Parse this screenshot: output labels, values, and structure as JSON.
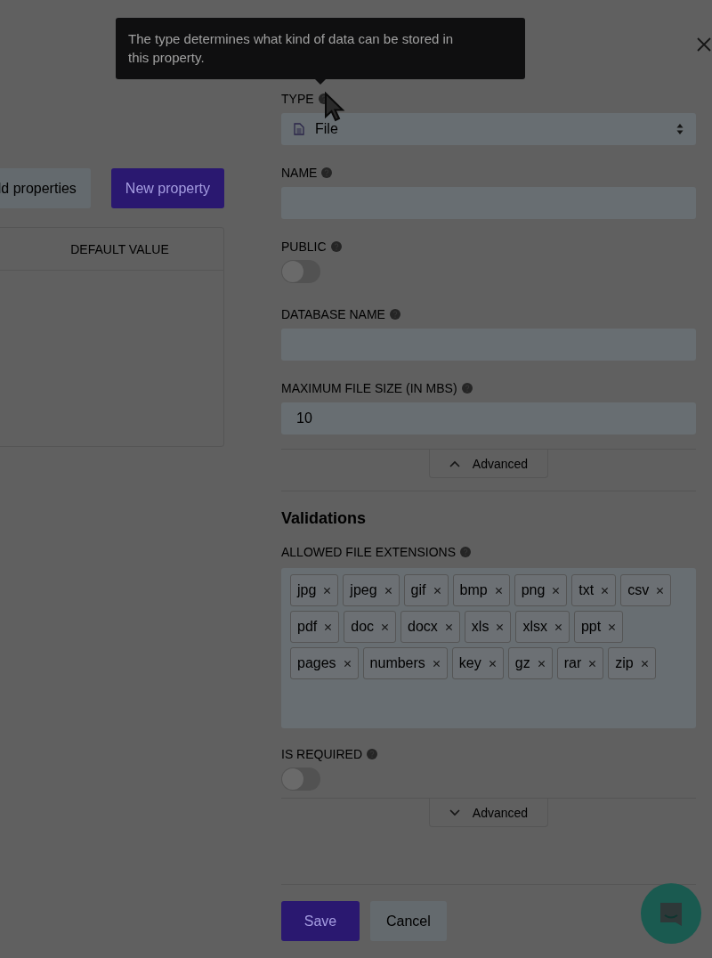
{
  "background_page": {
    "buttons": [
      {
        "label": "ld properties",
        "kind": "secondary"
      },
      {
        "label": "New property",
        "kind": "primary"
      }
    ],
    "table": {
      "columns": [
        "DEFAULT VALUE"
      ]
    }
  },
  "tooltip": {
    "text": "The type determines what kind of data can be stored in this property."
  },
  "form": {
    "fields": [
      {
        "label": "TYPE",
        "kind": "select",
        "value": "File"
      },
      {
        "label": "NAME",
        "kind": "text"
      },
      {
        "label": "PUBLIC",
        "kind": "toggle",
        "on": false
      },
      {
        "label": "DATABASE NAME",
        "kind": "text"
      },
      {
        "label": "MAXIMUM FILE SIZE (IN MBS)",
        "kind": "text",
        "value": "10"
      },
      {
        "label": "Advanced",
        "kind": "advanced",
        "expanded": true
      },
      {
        "label": "Validations",
        "kind": "heading"
      },
      {
        "label": "ALLOWED FILE EXTENSIONS",
        "kind": "tags",
        "rows": [
          [
            "jpg",
            "jpeg",
            "gif",
            "bmp",
            "png",
            "txt",
            "csv"
          ],
          [
            "pdf",
            "doc",
            "docx",
            "xls",
            "xlsx",
            "ppt"
          ],
          [
            "pages",
            "numbers",
            "key",
            "gz",
            "rar",
            "zip"
          ]
        ]
      },
      {
        "label": "IS REQUIRED",
        "kind": "toggle",
        "on": false
      },
      {
        "label": "Advanced",
        "kind": "advanced",
        "expanded": false
      }
    ]
  },
  "actions": [
    {
      "label": "Save",
      "kind": "primary"
    },
    {
      "label": "Cancel",
      "kind": "secondary"
    }
  ]
}
